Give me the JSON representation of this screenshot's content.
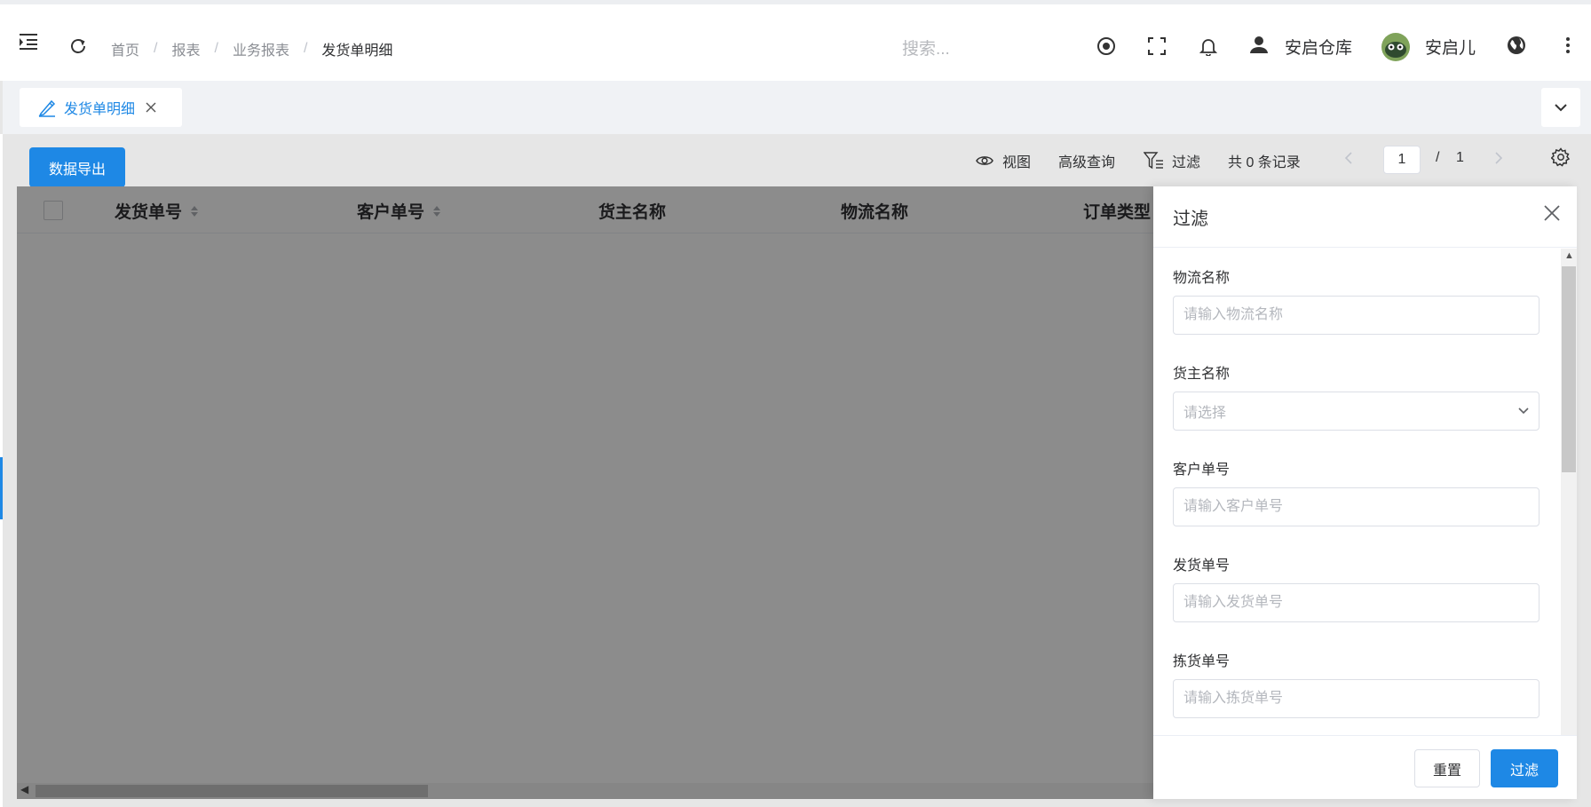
{
  "header": {
    "breadcrumbs": [
      "首页",
      "报表",
      "业务报表",
      "发货单明细"
    ],
    "search_placeholder": "搜索...",
    "warehouse_name": "安启仓库",
    "user_name": "安启儿"
  },
  "tabs": [
    {
      "label": "发货单明细",
      "active": true
    }
  ],
  "toolbar": {
    "export_label": "数据导出",
    "view_label": "视图",
    "advanced_query_label": "高级查询",
    "filter_label": "过滤",
    "record_count": "共 0 条记录",
    "current_page": "1",
    "page_separator": "/",
    "total_pages": "1"
  },
  "table": {
    "columns": [
      {
        "label": "发货单号",
        "sortable": true
      },
      {
        "label": "客户单号",
        "sortable": true
      },
      {
        "label": "货主名称",
        "sortable": false
      },
      {
        "label": "物流名称",
        "sortable": false
      },
      {
        "label": "订单类型",
        "sortable": false
      }
    ],
    "rows": []
  },
  "filter_drawer": {
    "title": "过滤",
    "fields": [
      {
        "label": "物流名称",
        "placeholder": "请输入物流名称",
        "type": "input"
      },
      {
        "label": "货主名称",
        "placeholder": "请选择",
        "type": "select"
      },
      {
        "label": "客户单号",
        "placeholder": "请输入客户单号",
        "type": "input"
      },
      {
        "label": "发货单号",
        "placeholder": "请输入发货单号",
        "type": "input"
      },
      {
        "label": "拣货单号",
        "placeholder": "请输入拣货单号",
        "type": "input"
      }
    ],
    "reset_label": "重置",
    "submit_label": "过滤"
  },
  "colors": {
    "primary": "#1e88e5",
    "overlay": "rgba(0,0,0,0.45)"
  }
}
